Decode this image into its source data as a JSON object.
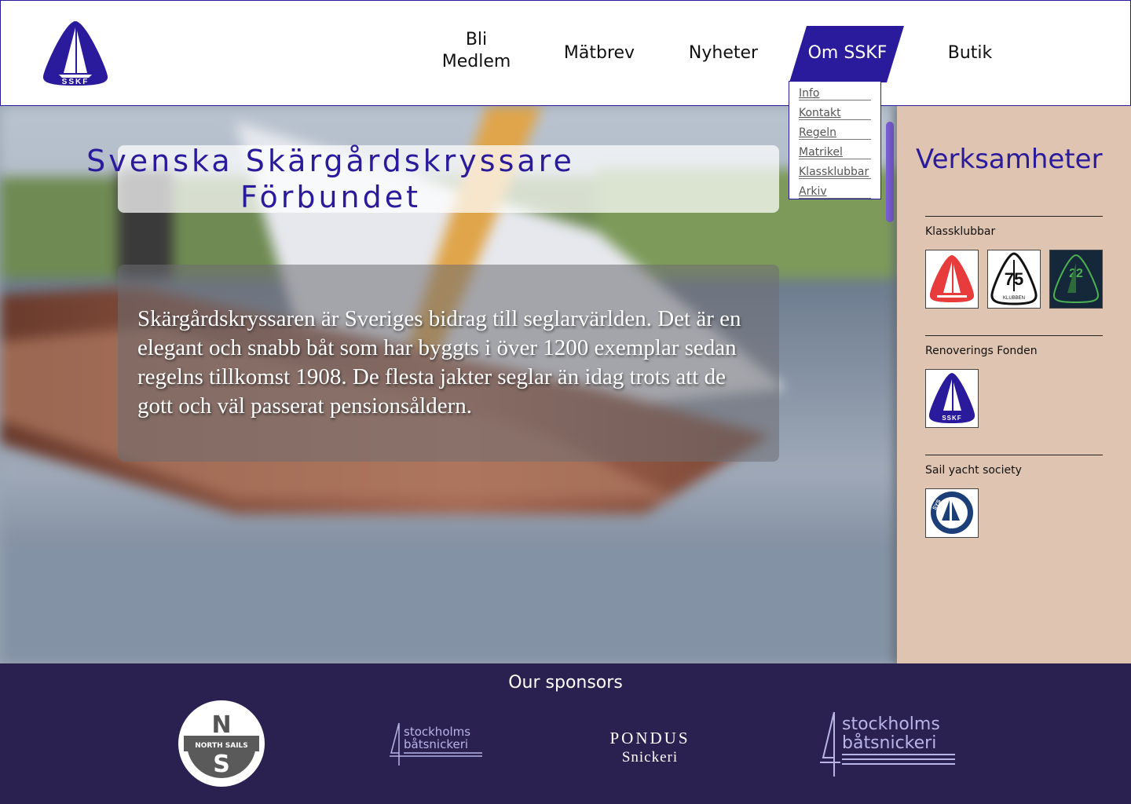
{
  "header": {
    "logo_alt": "SSKF",
    "nav": {
      "bli_line1": "Bli",
      "bli_line2": "Medlem",
      "matbrev": "Mätbrev",
      "nyheter": "Nyheter",
      "om": "Om SSKF",
      "butik": "Butik"
    },
    "active_color": "#2a1a9c"
  },
  "dropdown": {
    "items": [
      "Info",
      "Kontakt",
      "Regeln",
      "Matrikel",
      "Klassklubbar",
      "Arkiv"
    ]
  },
  "hero": {
    "title_line1": "Svenska Skärgårdskryssare",
    "title_line2": "Förbundet",
    "body": "Skärgårdskryssaren är Sveriges bidrag till seglarvärlden. Det är en elegant och snabb båt som har byggts i över 1200 exemplar sedan regelns tillkomst 1908. De flesta jakter seglar än idag trots att de gott och väl passerat pensionsåldern."
  },
  "sidebar": {
    "title": "Verksamheter",
    "sections": [
      {
        "label": "Klassklubbar",
        "logos": [
          "22 sqm club logo",
          "75 klubben logo",
          "22 club logo"
        ]
      },
      {
        "label": "Renoverings Fonden",
        "logos": [
          "SSKF logo"
        ]
      },
      {
        "label": "Sail yacht society",
        "logos": [
          "SYS logo"
        ]
      }
    ],
    "logo_text": {
      "sskf": "SSKF",
      "klubben": "KLUBBEN",
      "sys": "SYS",
      "sys_ring": "SAIL YACHT SOCIETY"
    },
    "background": "#dfc4b1"
  },
  "footer": {
    "title": "Our sponsors",
    "sponsors": {
      "northsails_n": "N",
      "northsails_name": "NORTH SAILS",
      "northsails_s": "S",
      "batsnickeri_1": "stockholms",
      "batsnickeri_2": "båtsnickeri",
      "pondus_1": "PONDUS",
      "pondus_2": "Snickeri"
    },
    "background": "#2a2150"
  }
}
